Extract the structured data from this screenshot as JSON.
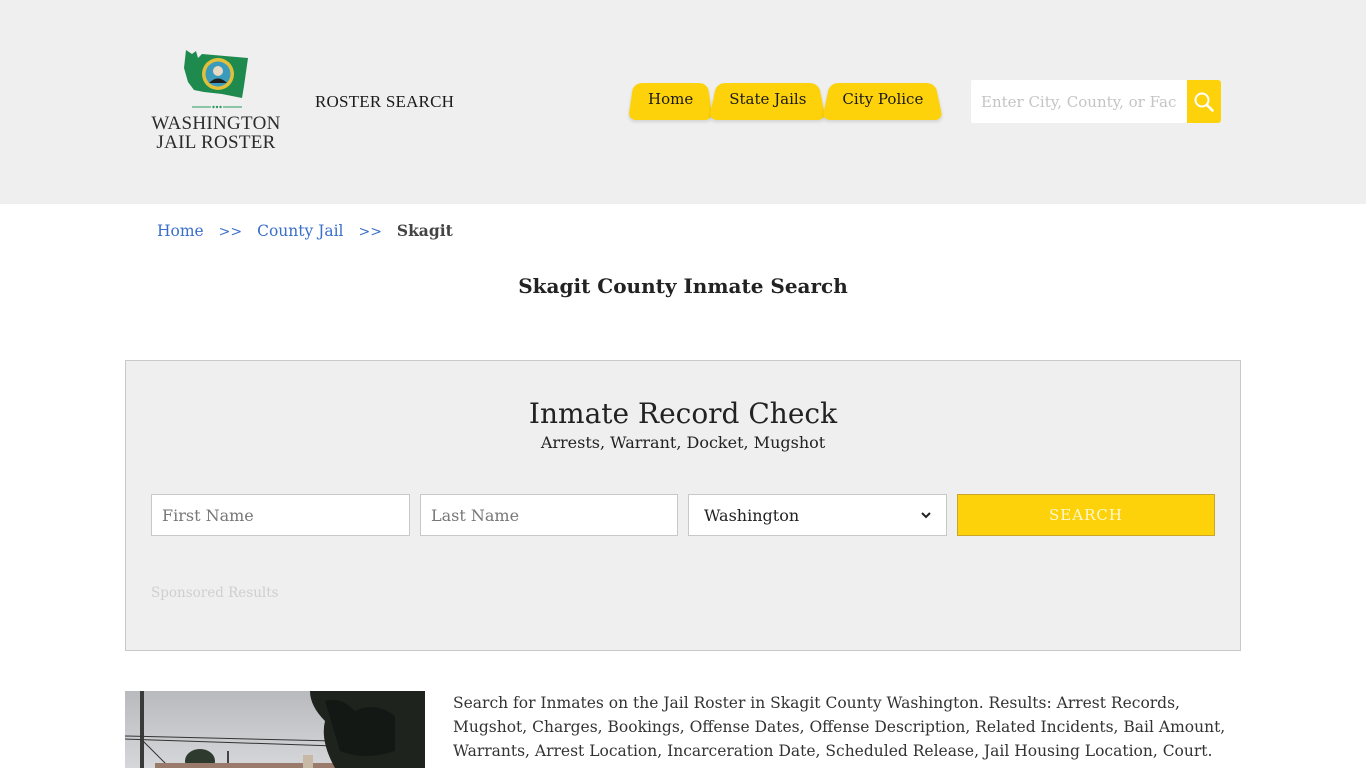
{
  "header": {
    "logo": {
      "line1": "WASHINGTON",
      "line2": "JAIL ROSTER",
      "icon": "washington-state-seal-map",
      "map_color": "#1e8a4e"
    },
    "roster_search_label": "ROSTER SEARCH",
    "nav": [
      {
        "label": "Home"
      },
      {
        "label": "State Jails"
      },
      {
        "label": "City Police"
      }
    ],
    "search": {
      "placeholder": "Enter City, County, or Facility",
      "icon": "search-icon"
    },
    "accent_color": "#fdd20a"
  },
  "breadcrumb": {
    "items": [
      {
        "label": "Home"
      },
      {
        "label": "County Jail"
      }
    ],
    "separator": ">>",
    "current": "Skagit"
  },
  "page_title": "Skagit County Inmate Search",
  "record_check": {
    "title": "Inmate Record Check",
    "subtitle": "Arrests, Warrant, Docket, Mugshot",
    "first_name_placeholder": "First Name",
    "last_name_placeholder": "Last Name",
    "state_selected": "Washington",
    "search_button": "SEARCH",
    "sponsored_label": "Sponsored Results"
  },
  "content": {
    "photo_alt": "Skagit County Jail building",
    "description": "Search for Inmates on the Jail Roster in Skagit County Washington. Results: Arrest Records, Mugshot, Charges, Bookings, Offense Dates, Offense Description, Related Incidents, Bail Amount, Warrants, Arrest Location, Incarceration Date, Scheduled Release, Jail Housing Location, Court."
  }
}
